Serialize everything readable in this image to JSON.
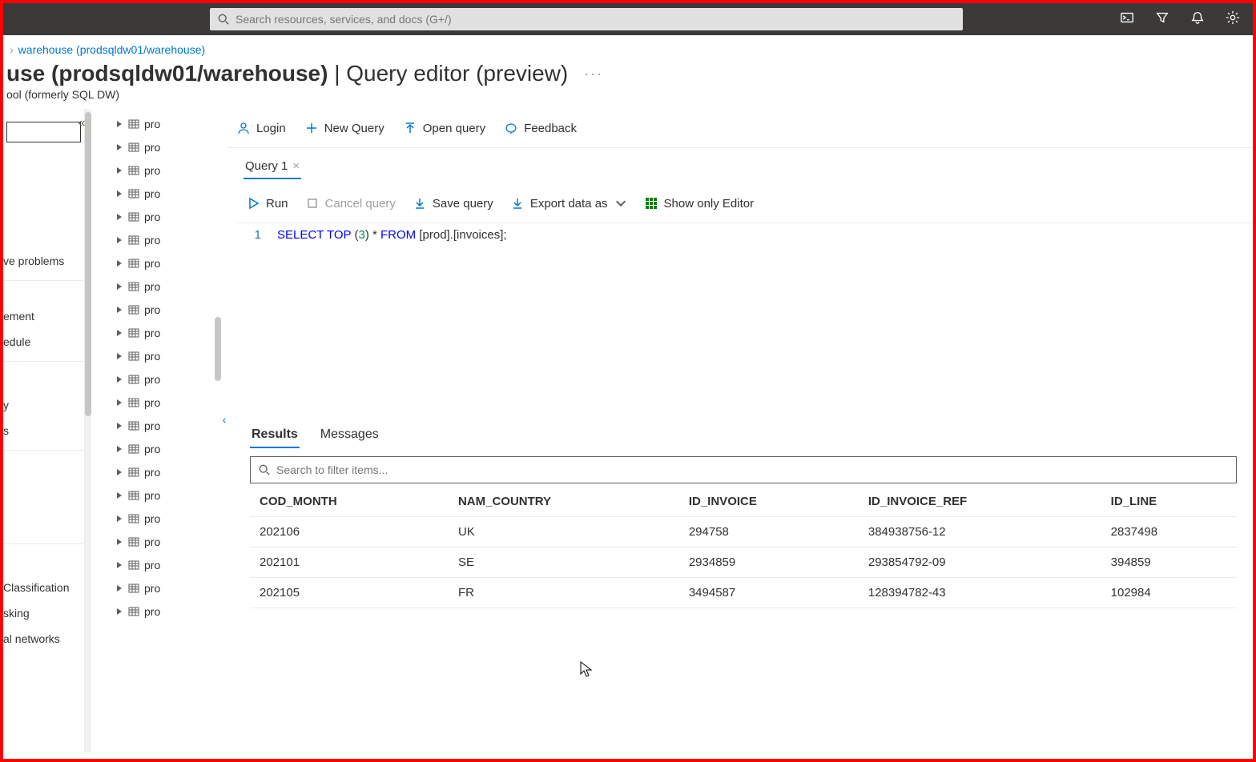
{
  "topbar": {
    "search_placeholder": "Search resources, services, and docs (G+/)"
  },
  "breadcrumb": {
    "link": "warehouse (prodsqldw01/warehouse)"
  },
  "title": {
    "prefix": "use (prodsqldw01/warehouse)",
    "suffix": " | Query editor (preview)",
    "subtitle": "ool (formerly SQL DW)"
  },
  "toolbar": {
    "login": "Login",
    "new_query": "New Query",
    "open_query": "Open query",
    "feedback": "Feedback"
  },
  "tabs": {
    "items": [
      {
        "label": "Query 1"
      }
    ]
  },
  "actionbar": {
    "run": "Run",
    "cancel": "Cancel query",
    "save": "Save query",
    "export": "Export data as",
    "show_editor": "Show only Editor"
  },
  "editor": {
    "line_no": "1",
    "kw1": "SELECT",
    "kw2": "TOP",
    "paren_open": "(",
    "num": "3",
    "paren_close": ")",
    "star": "*",
    "kw3": "FROM",
    "ident": "[prod].[invoices];"
  },
  "leftnav": {
    "items": [
      "ve problems",
      "ement",
      "edule",
      "y",
      "s",
      "Classification",
      "sking",
      "al networks"
    ]
  },
  "tree": {
    "label": "pro"
  },
  "results": {
    "tabs": {
      "results": "Results",
      "messages": "Messages"
    },
    "filter_placeholder": "Search to filter items...",
    "columns": [
      "COD_MONTH",
      "NAM_COUNTRY",
      "ID_INVOICE",
      "ID_INVOICE_REF",
      "ID_LINE"
    ],
    "rows": [
      [
        "202106",
        "UK",
        "294758",
        "384938756-12",
        "2837498"
      ],
      [
        "202101",
        "SE",
        "2934859",
        "293854792-09",
        "394859"
      ],
      [
        "202105",
        "FR",
        "3494587",
        "128394782-43",
        "102984"
      ]
    ]
  }
}
